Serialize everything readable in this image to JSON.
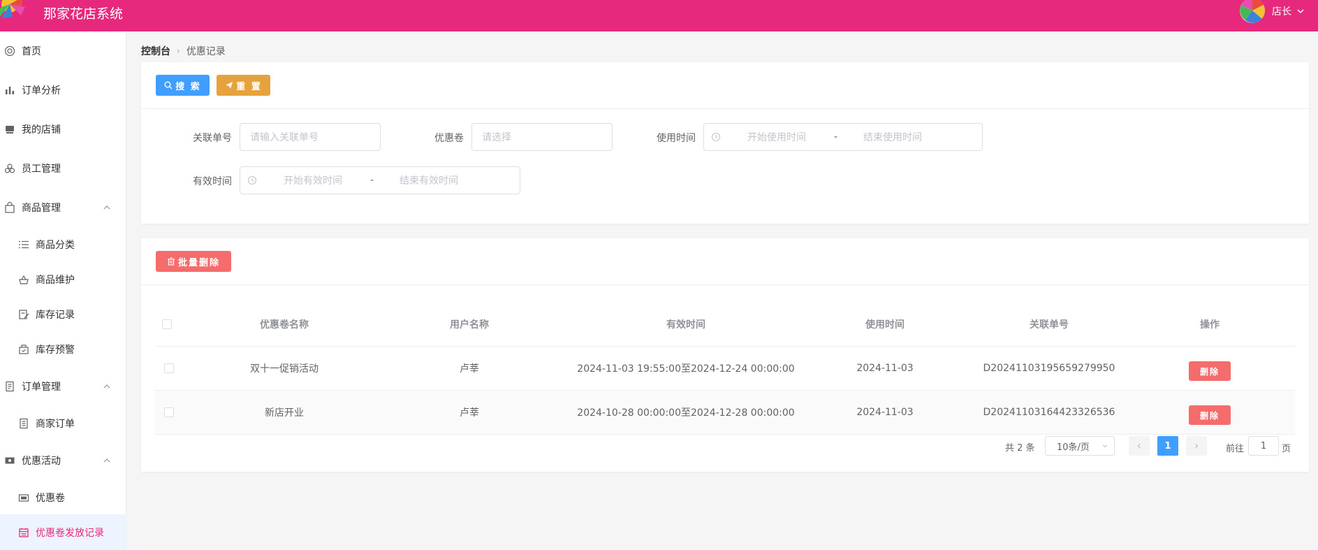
{
  "header": {
    "app_title": "那家花店系统",
    "user_name": "店长",
    "brand_color": "#e7297d"
  },
  "sidebar": {
    "items": [
      {
        "label": "首页",
        "icon": "home-icon"
      },
      {
        "label": "订单分析",
        "icon": "bar-chart-icon"
      },
      {
        "label": "我的店铺",
        "icon": "store-icon"
      },
      {
        "label": "员工管理",
        "icon": "users-icon"
      },
      {
        "label": "商品管理",
        "icon": "bag-icon",
        "expanded": true
      },
      {
        "label": "商品分类",
        "icon": "list-icon"
      },
      {
        "label": "商品维护",
        "icon": "basket-icon"
      },
      {
        "label": "库存记录",
        "icon": "edit-doc-icon"
      },
      {
        "label": "库存预警",
        "icon": "alert-box-icon"
      },
      {
        "label": "订单管理",
        "icon": "document-icon",
        "expanded": true
      },
      {
        "label": "商家订单",
        "icon": "order-icon"
      },
      {
        "label": "优惠活动",
        "icon": "ticket-icon",
        "expanded": true
      },
      {
        "label": "优惠卷",
        "icon": "coupon-icon"
      },
      {
        "label": "优惠卷发放记录",
        "icon": "calendar-icon",
        "active": true
      }
    ]
  },
  "breadcrumb": {
    "home": "控制台",
    "current": "优惠记录"
  },
  "search": {
    "search_label": "搜 索",
    "reset_label": "重 置",
    "fields": {
      "order_no_label": "关联单号",
      "order_no_placeholder": "请输入关联单号",
      "coupon_label": "优惠卷",
      "coupon_placeholder": "请选择",
      "use_time_label": "使用时间",
      "use_time_start": "开始使用时间",
      "use_time_end": "结束使用时间",
      "valid_time_label": "有效时间",
      "valid_time_start": "开始有效时间",
      "valid_time_end": "结束有效时间",
      "range_sep": "-"
    }
  },
  "table": {
    "batch_delete_label": "批量删除",
    "columns": [
      "优惠卷名称",
      "用户名称",
      "有效时间",
      "使用时间",
      "关联单号",
      "操作"
    ],
    "rows": [
      {
        "coupon": "双十一促销活动",
        "user": "卢莘",
        "valid": "2024-11-03 19:55:00至2024-12-24 00:00:00",
        "used": "2024-11-03",
        "order": "D20241103195659279950",
        "action": "删除"
      },
      {
        "coupon": "新店开业",
        "user": "卢莘",
        "valid": "2024-10-28 00:00:00至2024-12-28 00:00:00",
        "used": "2024-11-03",
        "order": "D20241103164423326536",
        "action": "删除"
      }
    ]
  },
  "pagination": {
    "total": "共 2 条",
    "page_size": "10条/页",
    "current": "1",
    "goto_prefix": "前往",
    "goto_value": "1",
    "goto_suffix": "页"
  }
}
